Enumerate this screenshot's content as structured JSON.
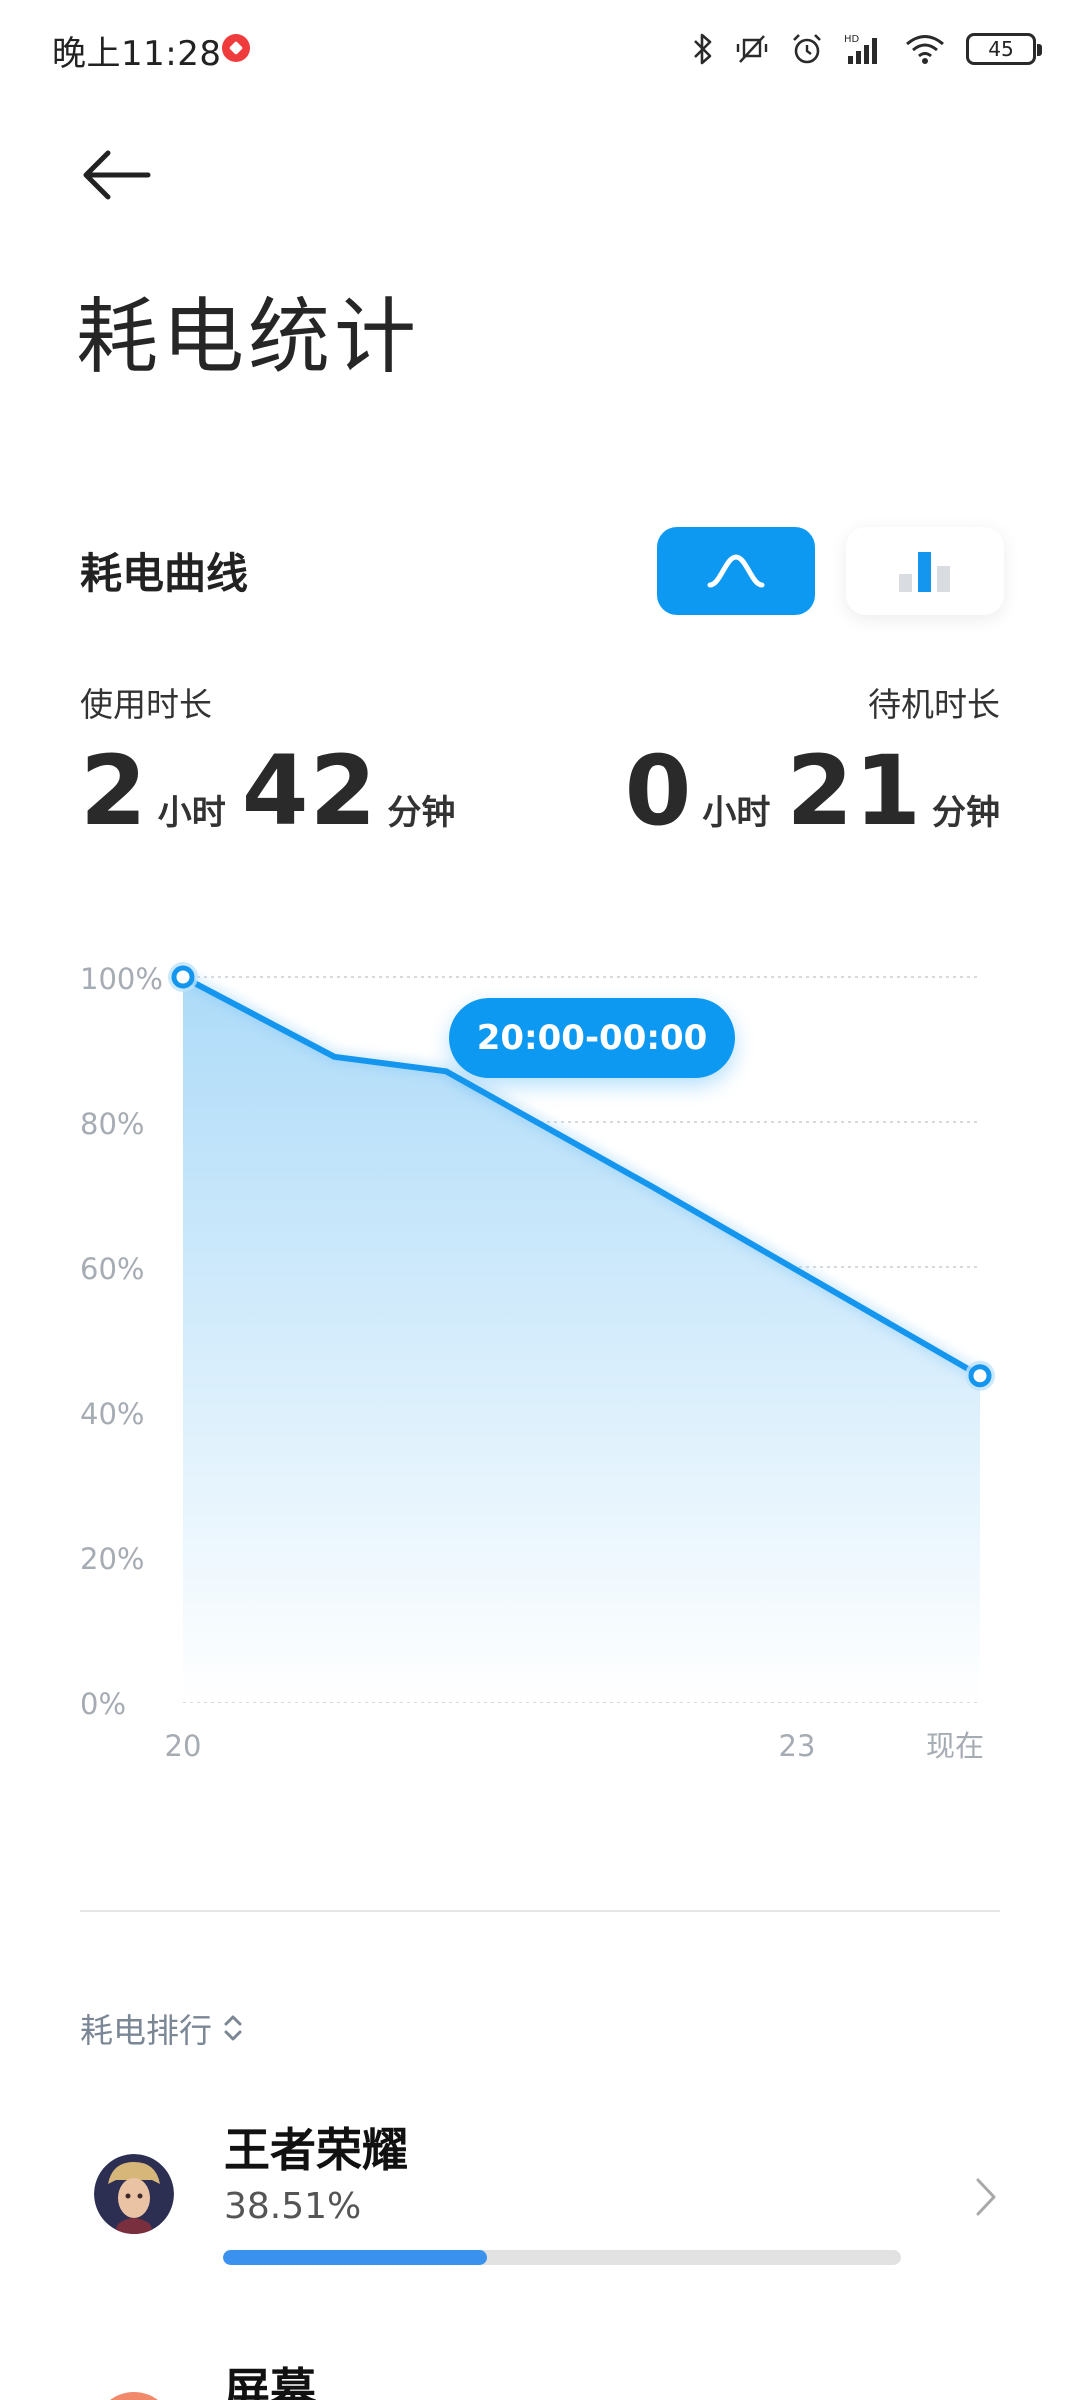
{
  "status_bar": {
    "time": "晚上11:28",
    "battery": "45",
    "icons": [
      "bluetooth-icon",
      "vibrate-off-icon",
      "alarm-icon",
      "hd-signal-icon",
      "wifi-icon",
      "battery-icon"
    ]
  },
  "page": {
    "title": "耗电统计"
  },
  "curve_section": {
    "title": "耗电曲线",
    "toggle_curve_icon": "curve-icon",
    "toggle_bars_icon": "bar-chart-icon",
    "active_view": "curve"
  },
  "usage": {
    "label": "使用时长",
    "hours": "2",
    "hours_unit": "小时",
    "minutes": "42",
    "minutes_unit": "分钟"
  },
  "standby": {
    "label": "待机时长",
    "hours": "0",
    "hours_unit": "小时",
    "minutes": "21",
    "minutes_unit": "分钟"
  },
  "chart_data": {
    "type": "area",
    "y_ticks": [
      "100%",
      "80%",
      "60%",
      "40%",
      "20%",
      "0%"
    ],
    "x_ticks": [
      "20",
      "23",
      "现在"
    ],
    "ylim": [
      0,
      100
    ],
    "x": [
      0,
      0.19,
      0.33,
      0.59,
      1.0
    ],
    "values": [
      100,
      89,
      87,
      71,
      45
    ],
    "tooltip": "20:00-00:00",
    "grid": true,
    "colors": {
      "line": "#1596ee",
      "fill_top": "#a9d9f8",
      "fill_bottom": "#ffffff"
    }
  },
  "ranking": {
    "sort_label": "耗电排行",
    "sort_icon": "sort-updown-icon",
    "items": [
      {
        "name": "王者荣耀",
        "percent": "38.51%",
        "progress": 0.39,
        "icon": "game-avatar-icon"
      },
      {
        "name": "屏幕",
        "icon": "screen-icon"
      }
    ]
  }
}
